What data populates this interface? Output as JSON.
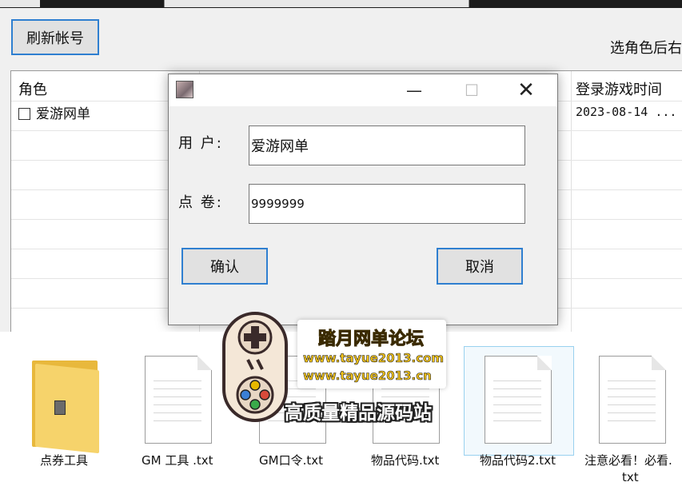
{
  "toolbar": {
    "refresh_label": "刷新帐号",
    "hint": "选角色后右"
  },
  "list": {
    "col_role": "角色",
    "col_login_time": "登录游戏时间",
    "rows": [
      {
        "role": "爱游网单",
        "login_time": "2023-08-14 ..."
      }
    ]
  },
  "dialog": {
    "user_label": "用 户:",
    "user_value": "爱游网单",
    "points_label": "点 卷:",
    "points_value": "9999999",
    "ok_label": "确认",
    "cancel_label": "取消"
  },
  "explorer": {
    "files": [
      {
        "name": "点券工具",
        "type": "folder"
      },
      {
        "name": "GM 工具 .txt",
        "type": "txt"
      },
      {
        "name": "GM口令.txt",
        "type": "txt"
      },
      {
        "name": "物品代码.txt",
        "type": "txt"
      },
      {
        "name": "物品代码2.txt",
        "type": "txt",
        "selected": true
      },
      {
        "name": "注意必看！必看.",
        "name_line2": "txt",
        "type": "txt"
      }
    ]
  },
  "watermark": {
    "title": "踏月网单论坛",
    "url1": "www.tayue2013.com",
    "url2": "www.tayue2013.cn",
    "slogan": "高质量精品源码站"
  },
  "colors": {
    "accent": "#2f7fd0",
    "watermark_yellow": "#f1c40f",
    "window_bg": "#f0f0f0"
  }
}
